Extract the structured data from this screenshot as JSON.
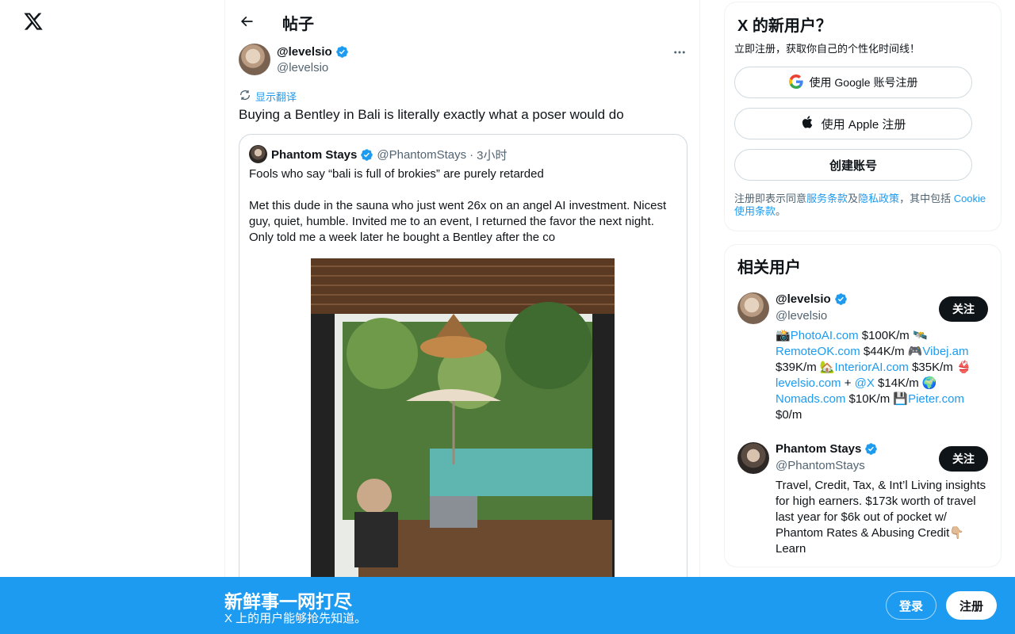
{
  "header": {
    "title": "帖子"
  },
  "tweet": {
    "author_name": "@levelsio",
    "author_handle": "@levelsio",
    "translate_label": "显示翻译",
    "text": "Buying a Bentley in Bali is literally exactly what a poser would do"
  },
  "quote": {
    "name": "Phantom Stays",
    "handle": "@PhantomStays",
    "separator": "·",
    "time": "3小时",
    "text_line1": "Fools who say “bali is full of brokies” are purely retarded",
    "text_line2": "Met this dude in the sauna who just went 26x on an angel AI investment. Nicest guy, quiet, humble. Invited me to an event, I returned the favor the next night. Only told me a week later he bought a Bentley after the co"
  },
  "signup_card": {
    "title": "X 的新用户？",
    "subtitle": "立即注册，获取你自己的个性化时间线！",
    "google_label": "使用 Google 账号注册",
    "apple_label": "使用 Apple 注册",
    "create_label": "创建账号",
    "terms_prefix": "注册即表示同意",
    "terms_link": "服务条款",
    "terms_and": "及",
    "privacy_link": "隐私政策",
    "terms_mid": "，其中包括 ",
    "cookie_link": "Cookie 使用条款",
    "terms_end": "。"
  },
  "related": {
    "title": "相关用户",
    "users": [
      {
        "name": "@levelsio",
        "handle": "@levelsio",
        "follow_label": "关注",
        "bio": [
          {
            "t": "📸",
            "link": false
          },
          {
            "t": "PhotoAI.com",
            "link": true
          },
          {
            "t": " $100K/m 🛰️ ",
            "link": false
          },
          {
            "t": "RemoteOK.com",
            "link": true
          },
          {
            "t": " $44K/m 🎮",
            "link": false
          },
          {
            "t": "Vibej.am",
            "link": true
          },
          {
            "t": " $39K/m 🏡",
            "link": false
          },
          {
            "t": "InteriorAI.com",
            "link": true
          },
          {
            "t": " $35K/m 👙 ",
            "link": false
          },
          {
            "t": "levelsio.com",
            "link": true
          },
          {
            "t": " + ",
            "link": false
          },
          {
            "t": "@X",
            "link": true
          },
          {
            "t": " $14K/m 🌍 ",
            "link": false
          },
          {
            "t": "Nomads.com",
            "link": true
          },
          {
            "t": " $10K/m 💾",
            "link": false
          },
          {
            "t": "Pieter.com",
            "link": true
          },
          {
            "t": " $0/m",
            "link": false
          }
        ]
      },
      {
        "name": "Phantom Stays",
        "handle": "@PhantomStays",
        "follow_label": "关注",
        "bio_text": "Travel, Credit, Tax, & Int’l Living insights for high earners. $173k worth of travel last year for $6k out of pocket w/ Phantom Rates & Abusing Credit👇🏼 Learn"
      }
    ]
  },
  "banner": {
    "title": "新鲜事一网打尽",
    "subtitle": "X 上的用户能够抢先知道。",
    "login_label": "登录",
    "signup_label": "注册"
  },
  "colors": {
    "accent": "#1d9bf0",
    "text": "#0f1419",
    "muted": "#536471",
    "border": "#cfd9de"
  },
  "icons": [
    "x-logo-icon",
    "back-arrow-icon",
    "verified-badge-icon",
    "more-icon",
    "translate-icon",
    "google-icon",
    "apple-icon"
  ]
}
